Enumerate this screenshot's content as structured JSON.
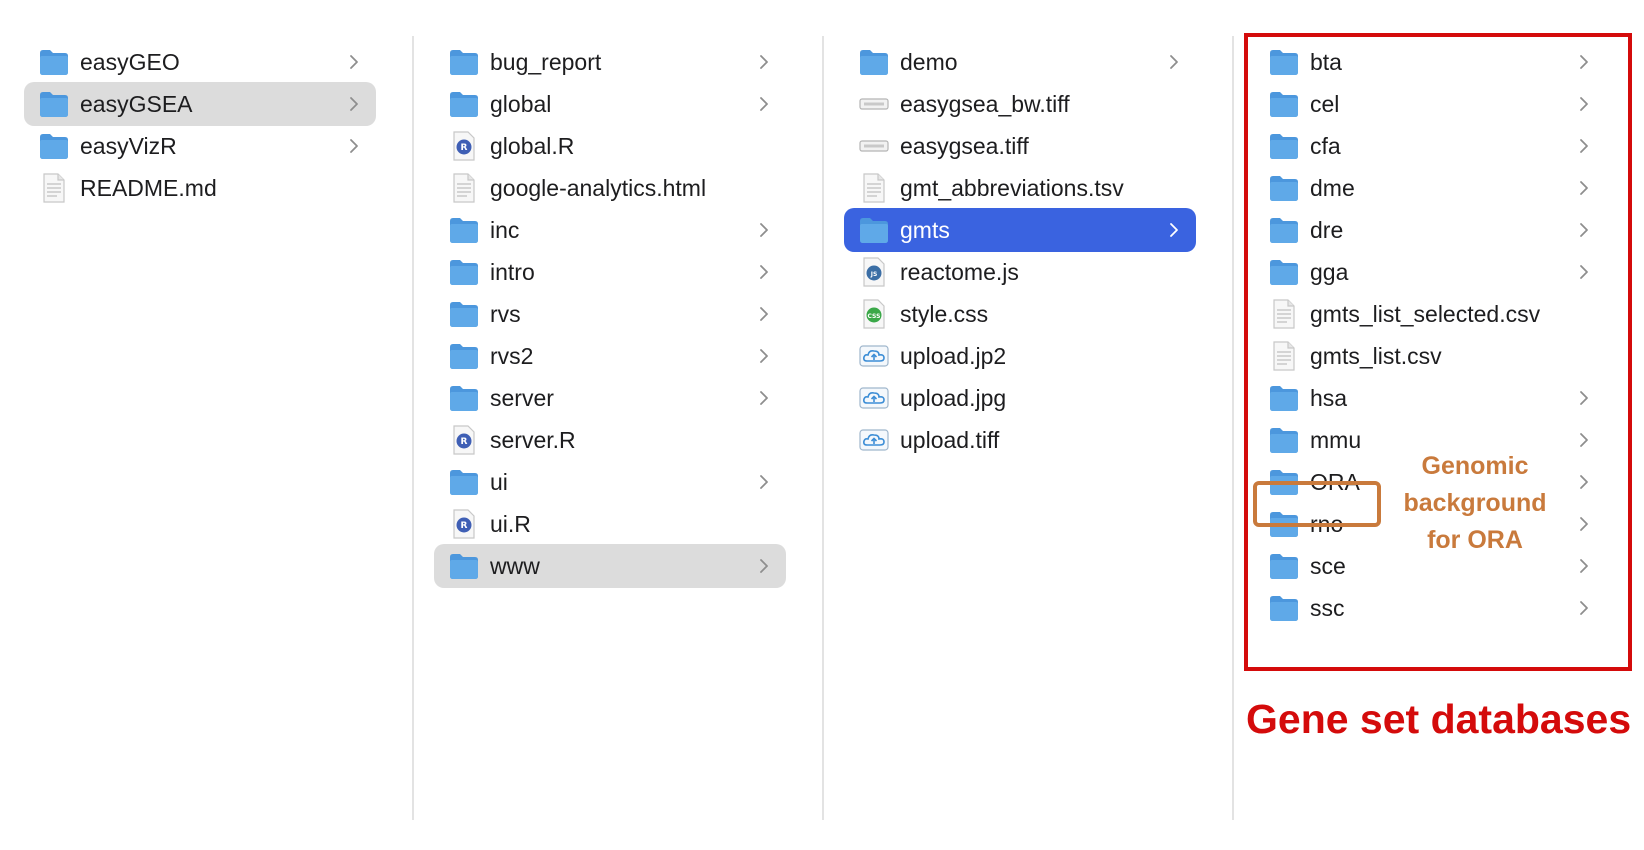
{
  "columns": [
    {
      "items": [
        {
          "label": "easyGEO",
          "icon": "folder-icon",
          "chevron": true,
          "state": ""
        },
        {
          "label": "easyGSEA",
          "icon": "folder-icon",
          "chevron": true,
          "state": "gray"
        },
        {
          "label": "easyVizR",
          "icon": "folder-icon",
          "chevron": true,
          "state": ""
        },
        {
          "label": "README.md",
          "icon": "document-icon",
          "chevron": false,
          "state": ""
        }
      ]
    },
    {
      "items": [
        {
          "label": "bug_report",
          "icon": "folder-icon",
          "chevron": true,
          "state": ""
        },
        {
          "label": "global",
          "icon": "folder-icon",
          "chevron": true,
          "state": ""
        },
        {
          "label": "global.R",
          "icon": "r-file-icon",
          "chevron": false,
          "state": ""
        },
        {
          "label": "google-analytics.html",
          "icon": "document-icon",
          "chevron": false,
          "state": ""
        },
        {
          "label": "inc",
          "icon": "folder-icon",
          "chevron": true,
          "state": ""
        },
        {
          "label": "intro",
          "icon": "folder-icon",
          "chevron": true,
          "state": ""
        },
        {
          "label": "rvs",
          "icon": "folder-icon",
          "chevron": true,
          "state": ""
        },
        {
          "label": "rvs2",
          "icon": "folder-icon",
          "chevron": true,
          "state": ""
        },
        {
          "label": "server",
          "icon": "folder-icon",
          "chevron": true,
          "state": ""
        },
        {
          "label": "server.R",
          "icon": "r-file-icon",
          "chevron": false,
          "state": ""
        },
        {
          "label": "ui",
          "icon": "folder-icon",
          "chevron": true,
          "state": ""
        },
        {
          "label": "ui.R",
          "icon": "r-file-icon",
          "chevron": false,
          "state": ""
        },
        {
          "label": "www",
          "icon": "folder-icon",
          "chevron": true,
          "state": "gray"
        }
      ]
    },
    {
      "items": [
        {
          "label": "demo",
          "icon": "folder-icon",
          "chevron": true,
          "state": ""
        },
        {
          "label": "easygsea_bw.tiff",
          "icon": "image-file-icon",
          "chevron": false,
          "state": ""
        },
        {
          "label": "easygsea.tiff",
          "icon": "image-file-icon",
          "chevron": false,
          "state": ""
        },
        {
          "label": "gmt_abbreviations.tsv",
          "icon": "document-icon",
          "chevron": false,
          "state": ""
        },
        {
          "label": "gmts",
          "icon": "folder-icon",
          "chevron": true,
          "state": "blue"
        },
        {
          "label": "reactome.js",
          "icon": "js-file-icon",
          "chevron": false,
          "state": ""
        },
        {
          "label": "style.css",
          "icon": "css-file-icon",
          "chevron": false,
          "state": ""
        },
        {
          "label": "upload.jp2",
          "icon": "cloud-upload-icon",
          "chevron": false,
          "state": ""
        },
        {
          "label": "upload.jpg",
          "icon": "cloud-upload-icon",
          "chevron": false,
          "state": ""
        },
        {
          "label": "upload.tiff",
          "icon": "cloud-upload-icon",
          "chevron": false,
          "state": ""
        }
      ]
    },
    {
      "items": [
        {
          "label": "bta",
          "icon": "folder-icon",
          "chevron": true,
          "state": ""
        },
        {
          "label": "cel",
          "icon": "folder-icon",
          "chevron": true,
          "state": ""
        },
        {
          "label": "cfa",
          "icon": "folder-icon",
          "chevron": true,
          "state": ""
        },
        {
          "label": "dme",
          "icon": "folder-icon",
          "chevron": true,
          "state": ""
        },
        {
          "label": "dre",
          "icon": "folder-icon",
          "chevron": true,
          "state": ""
        },
        {
          "label": "gga",
          "icon": "folder-icon",
          "chevron": true,
          "state": ""
        },
        {
          "label": "gmts_list_selected.csv",
          "icon": "document-icon",
          "chevron": false,
          "state": ""
        },
        {
          "label": "gmts_list.csv",
          "icon": "document-icon",
          "chevron": false,
          "state": ""
        },
        {
          "label": "hsa",
          "icon": "folder-icon",
          "chevron": true,
          "state": ""
        },
        {
          "label": "mmu",
          "icon": "folder-icon",
          "chevron": true,
          "state": ""
        },
        {
          "label": "ORA",
          "icon": "folder-icon",
          "chevron": true,
          "state": ""
        },
        {
          "label": "rno",
          "icon": "folder-icon",
          "chevron": true,
          "state": ""
        },
        {
          "label": "sce",
          "icon": "folder-icon",
          "chevron": true,
          "state": ""
        },
        {
          "label": "ssc",
          "icon": "folder-icon",
          "chevron": true,
          "state": ""
        }
      ]
    }
  ],
  "annotations": {
    "ora_note": [
      "Genomic",
      "background",
      "for ORA"
    ],
    "gene_set_title": "Gene set databases"
  },
  "colors": {
    "selected_blue": "#3a63e0",
    "selected_gray": "#dcdcdc",
    "annotation_red": "#d40b0b",
    "annotation_orange": "#c97a3c",
    "folder_blue": "#5fa9e8"
  }
}
